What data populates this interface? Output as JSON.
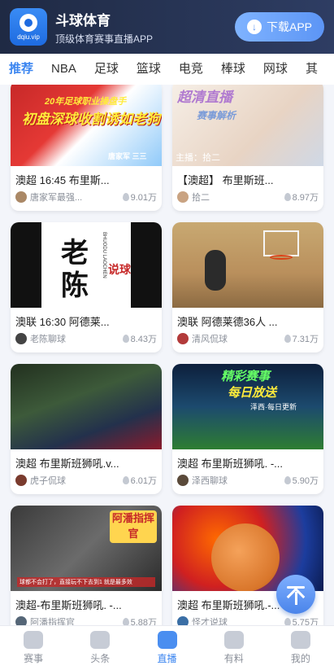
{
  "banner": {
    "logo_domain": "dqiu.vip",
    "app_name": "斗球体育",
    "slogan": "顶级体育赛事直播APP",
    "download_label": "下载APP"
  },
  "tabs": [
    "推荐",
    "NBA",
    "足球",
    "篮球",
    "电竞",
    "棒球",
    "网球",
    "其"
  ],
  "active_tab": "推荐",
  "cards": [
    {
      "title": "澳超 16:45 布里斯...",
      "streamer": "唐家军最强...",
      "heat": "9.01万",
      "thumb_text": [
        "20年足球职业操盘手",
        "初盘深球收割诱如老狗",
        "唐家军 三三"
      ]
    },
    {
      "title": "【澳超】 布里斯班...",
      "streamer": "拾二",
      "heat": "8.97万",
      "thumb_text": [
        "超清直播",
        "赛事解析",
        "主播：拾二"
      ]
    },
    {
      "title": "澳联 16:30 阿德莱...",
      "streamer": "老陈聊球",
      "heat": "8.43万",
      "thumb_text": [
        "老",
        "陈",
        "说球",
        "BHUODU LAOCHEN"
      ]
    },
    {
      "title": "澳联 阿德莱德36人 ...",
      "streamer": "清风侃球",
      "heat": "7.31万",
      "thumb_text": []
    },
    {
      "title": "澳超 布里斯班狮吼.v...",
      "streamer": "虎子侃球",
      "heat": "6.01万",
      "thumb_text": []
    },
    {
      "title": "澳超 布里斯班狮吼. -...",
      "streamer": "泽西聊球",
      "heat": "5.90万",
      "thumb_text": [
        "精彩赛事",
        "每日放送",
        "泽西·每日更新"
      ]
    },
    {
      "title": "澳超-布里斯班狮吼. -...",
      "streamer": "阿潘指挥官",
      "heat": "5.88万",
      "thumb_text": [
        "阿潘指挥官",
        "球都不会打了，直接玩不下去到1 就是最多效"
      ]
    },
    {
      "title": "澳超 布里斯班狮吼.-...",
      "streamer": "怪才说球",
      "heat": "5.75万",
      "thumb_text": []
    }
  ],
  "bottom_nav": [
    {
      "label": "赛事",
      "icon": "trophy-icon"
    },
    {
      "label": "头条",
      "icon": "news-icon"
    },
    {
      "label": "直播",
      "icon": "live-tv-icon"
    },
    {
      "label": "有料",
      "icon": "bulb-icon"
    },
    {
      "label": "我的",
      "icon": "profile-icon"
    }
  ],
  "active_nav": "直播",
  "colors": {
    "accent": "#3c86f0",
    "banner_bg": "#1f2a44",
    "page_bg": "#f3f5fa"
  }
}
